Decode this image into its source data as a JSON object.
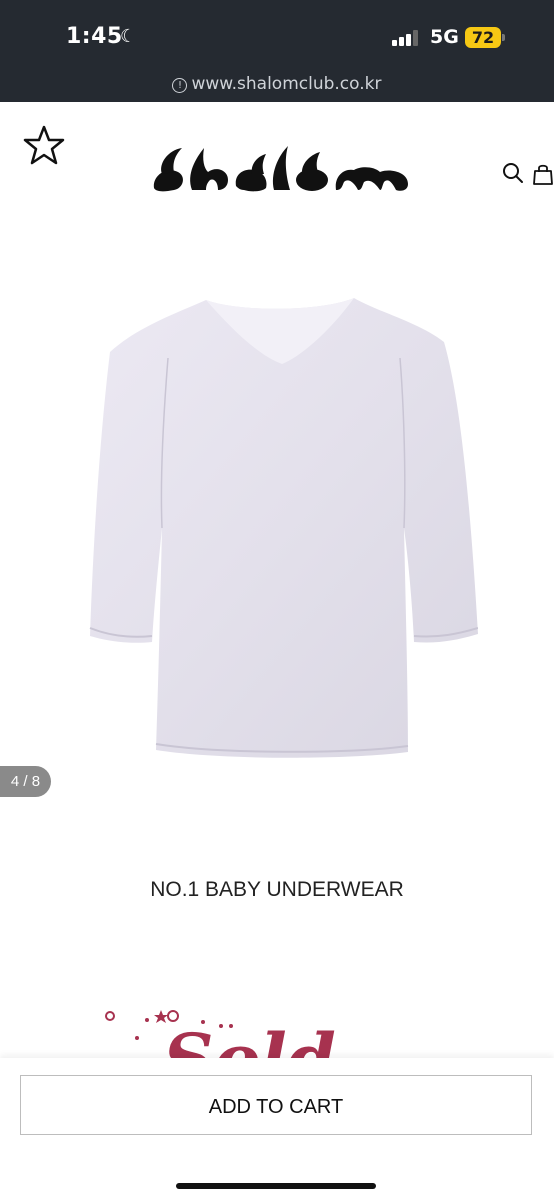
{
  "status_bar": {
    "time": "1:45",
    "network": "5G",
    "battery": "72",
    "url": "www.shalomclub.co.kr",
    "icons": [
      "moon-icon",
      "signal-icon",
      "battery-icon",
      "info-icon"
    ]
  },
  "header": {
    "logo_text": "shalom",
    "icons": [
      "star-icon",
      "search-icon",
      "shopping-bag-icon"
    ]
  },
  "gallery": {
    "counter": "4 / 8"
  },
  "product": {
    "title": "NO.1 BABY UNDERWEAR",
    "sold_text": "Sold"
  },
  "cart": {
    "button_label": "ADD TO CART"
  },
  "colors": {
    "status_bg": "#252a31",
    "battery": "#f6c814",
    "sold_badge": "#a7324f"
  }
}
